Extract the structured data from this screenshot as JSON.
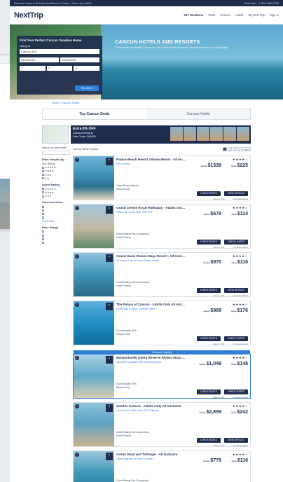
{
  "topbar": {
    "left": "Reserve Cancun All Inclusive Resorts Today - Save Up to 60%",
    "right": "Chat Now  ·  1-800-998-5758"
  },
  "logo": "NextTrip",
  "nav": [
    "247 Vacations",
    "Tours",
    "Cruises",
    "Hotels",
    "My Next Trip",
    "Sign In"
  ],
  "search": {
    "title": "Find Your Perfect Cancun Vacation Home",
    "going_to_label": "Going to",
    "going_to": "Cancun, MX",
    "checkin": "04/16/2023",
    "checkout": "04/23/2023",
    "rooms": "1",
    "adults": "2",
    "children": "0",
    "button": "SEARCH"
  },
  "hero": {
    "title": "CANCUN HOTELS AND RESORTS",
    "subtitle": "Check Hotel Availability\nCancun is one of the world's top beach destinations with non-stop flights"
  },
  "breadcrumb": "Home > Cancun Hotels",
  "tabs": [
    "Top Cancun Deals",
    "Cancun Hotels"
  ],
  "promo": {
    "line1": "Extra 8% OFF",
    "line2": "Cancun Resorts",
    "line3": "Use Code: SAVE8"
  },
  "sidebar": {
    "search_label": "Search by hotel name",
    "filter_title": "Filter Results By",
    "star_rating": "Star Rating",
    "guest_rating": "Guest Rating",
    "amenities": "Hotel Amenities",
    "more": "Show More",
    "price": "Price Range"
  },
  "results": {
    "sort_label": "Sort by: Most Popular",
    "pages": [
      "1",
      "2",
      "3",
      "4",
      "Next"
    ]
  },
  "cards": [
    {
      "name": "Palace Beach Resort Xihuna Beach - All Inclusive",
      "stars": "★★★★☆",
      "link": "View Details",
      "meta": "Great Beach Resort\nReport Only",
      "old": "$2099",
      "price": "$1539",
      "old2": "$289",
      "price2": "$225",
      "btn1": "CHECK RATES",
      "btn2": "VIEW DETAILS",
      "f1": "Save to Trip",
      "f2": "Compare Hotels"
    },
    {
      "name": "Grand Sirenis Royal Hideaway - Adults Only, All Inclusive",
      "stars": "★★★★☆",
      "link": "Hotel Fall Online Offer 25% OFF",
      "meta": "Great Rating Fair Connection\nHotel Pricing",
      "old": "$3001",
      "price": "$679",
      "old2": "$250",
      "price2": "$114",
      "btn1": "CHECK RATES",
      "btn2": "CHECK RATES",
      "f1": "Save to Trip",
      "f2": "Compare Hotels"
    },
    {
      "name": "Grand Oasis Riviera Maya Resort - All Inclusive",
      "stars": "★★★★☆",
      "link": "Exclusive Deal at Grand Resort Hotels",
      "meta": "Great Rating Fair Connection\nHotel Pricing",
      "old": "$1089",
      "price": "$970",
      "old2": "$245",
      "price2": "$116",
      "btn1": "CHECK RATES",
      "btn2": "VIEW DETAILS",
      "f1": "Save to Trip",
      "f2": "Compare Hotels"
    },
    {
      "name": "The Palace at Cancun - Adults Only All Inclusive",
      "stars": "★★★★☆",
      "link": "Hotel Grad Culpart - Special Offers",
      "meta": "Good Activity SPA\nReport Only",
      "old": "$1145",
      "price": "$989",
      "old2": "$212",
      "price2": "$176",
      "btn1": "CHECK RATES",
      "btn2": "CHECK RATES",
      "f1": "Save to Trip",
      "f2": "Compare Hotels"
    },
    {
      "name": "Margaritaville Island Reserve Riviera Maya - Adults Only All Inclusive",
      "stars": "★★★★☆",
      "link": "Exclusive Upgrade Offer Recommended",
      "meta": "Good Activity SPA\nReport Only",
      "old": "$1215",
      "price": "$1,049",
      "old2": "$264",
      "price2": "$148",
      "btn1": "CHECK RATES",
      "btn2": "CHECK RATES",
      "f1": "Save to Trip",
      "f2": "Compare Hotels",
      "featured": "Featured Property"
    },
    {
      "name": "Sandos Cancun - Adults Only All Inclusive",
      "stars": "★★★★☆",
      "link": "Limited Time Offer Save 35% Offering",
      "meta": "Great Rating Fair Connection\nHotel Pricing",
      "old": "$3410",
      "price": "$2,899",
      "old2": "$270",
      "price2": "$242",
      "btn1": "CHECK RATES",
      "btn2": "VIEW DETAILS",
      "f1": "Save to Trip",
      "f2": "Compare Hotels"
    },
    {
      "name": "Ocean Dead and Tottoope - All Inclusive",
      "stars": "★★★★☆",
      "link": "Great Upgrade at Every Location",
      "meta": "Good Rating Fair Connection\nHotel Pricing",
      "old": "$1094",
      "price": "$779",
      "old2": "$130",
      "price2": "$116",
      "btn1": "CHECK RATES",
      "btn2": "CHECK RATES",
      "f1": "Save to Trip",
      "f2": "Compare Hotels"
    }
  ],
  "colors": {
    "navy": "#1e2d4d",
    "accent": "#2f7fd6"
  }
}
